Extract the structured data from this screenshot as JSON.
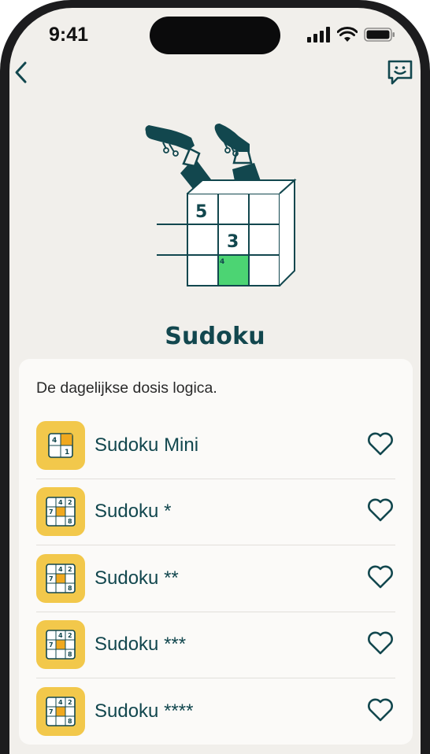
{
  "status": {
    "time": "9:41"
  },
  "header": {
    "back_icon": "chevron-left-icon",
    "feedback_icon": "smiley-chat-icon"
  },
  "illustration": {
    "cell_numbers": [
      "5",
      "3",
      "4"
    ],
    "highlight_color": "#4cd473"
  },
  "page": {
    "title": "Sudoku"
  },
  "card": {
    "description": "De dagelijkse dosis logica.",
    "games": [
      {
        "label": "Sudoku Mini",
        "icon": "mini-sudoku-icon",
        "favorite": false
      },
      {
        "label": "Sudoku *",
        "icon": "sudoku-icon",
        "favorite": false
      },
      {
        "label": "Sudoku **",
        "icon": "sudoku-icon",
        "favorite": false
      },
      {
        "label": "Sudoku ***",
        "icon": "sudoku-icon",
        "favorite": false
      },
      {
        "label": "Sudoku ****",
        "icon": "sudoku-icon",
        "favorite": false
      }
    ]
  },
  "colors": {
    "brand": "#12474e",
    "accent": "#f2c84b",
    "background": "#f1efeb"
  }
}
